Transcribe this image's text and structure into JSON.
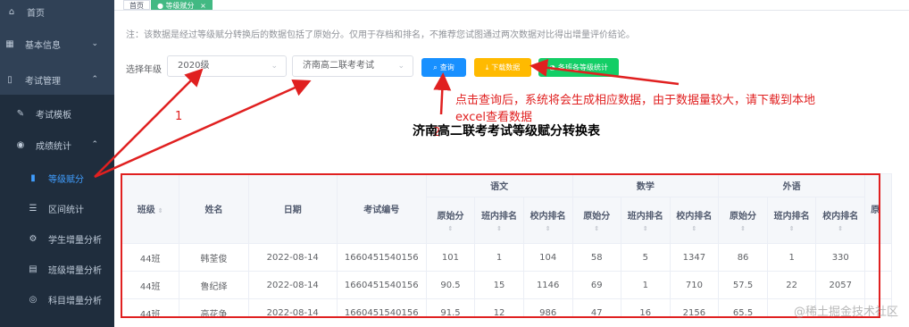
{
  "sidebar": {
    "items": [
      {
        "icon": "home-icon",
        "glyph": "⌂",
        "label": "首页"
      },
      {
        "icon": "grid-icon",
        "glyph": "▦",
        "label": "基本信息"
      },
      {
        "icon": "book-icon",
        "glyph": "▯",
        "label": "考试管理"
      },
      {
        "icon": "document-icon",
        "glyph": "✎",
        "label": "考试模板"
      },
      {
        "icon": "eye-icon",
        "glyph": "◉",
        "label": "成绩统计"
      },
      {
        "icon": "bar-chart-icon",
        "glyph": "▮",
        "label": "等级赋分"
      },
      {
        "icon": "list-icon",
        "glyph": "☰",
        "label": "区间统计"
      },
      {
        "icon": "gear-icon",
        "glyph": "⚙",
        "label": "学生增量分析"
      },
      {
        "icon": "table-icon",
        "glyph": "▤",
        "label": "班级增量分析"
      },
      {
        "icon": "circle-icon",
        "glyph": "◎",
        "label": "科目增量分析"
      }
    ]
  },
  "tabs": [
    {
      "label": "首页"
    },
    {
      "label": "● 等级赋分",
      "close": "×"
    }
  ],
  "notice": "注：该数据是经过等级赋分转换后的数据包括了原始分。仅用于存档和排名，不推荐您试图通过两次数据对比得出增量评价结论。",
  "filter": {
    "grade_label": "选择年级",
    "grade_value": "2020级",
    "exam_value": "济南高二联考考试",
    "query_label": "查询",
    "download_label": "下载数据",
    "stats_label": "各班各等级统计"
  },
  "annotations": {
    "num1": "1",
    "num2": "2",
    "hint_line1": "点击查询后，系统将会生成相应数据，由于数据量较大，请下载到本地",
    "hint_line2": "excel查看数据"
  },
  "table_title": "济南高二联考考试等级赋分转换表",
  "table": {
    "fixed_headers": [
      "班级",
      "姓名",
      "日期",
      "考试编号"
    ],
    "subject_groups": [
      "语文",
      "数学",
      "外语"
    ],
    "sub_headers": [
      "原始分",
      "班内排名",
      "校内排名"
    ],
    "overflow_header": "原",
    "rows": [
      [
        "44班",
        "韩荃俊",
        "2022-08-14",
        "1660451540156",
        "101",
        "1",
        "104",
        "58",
        "5",
        "1347",
        "86",
        "1",
        "330"
      ],
      [
        "44班",
        "鲁纪绎",
        "2022-08-14",
        "1660451540156",
        "90.5",
        "15",
        "1146",
        "69",
        "1",
        "710",
        "57.5",
        "22",
        "2057"
      ],
      [
        "44班",
        "高花争",
        "2022-08-14",
        "1660451540156",
        "91.5",
        "12",
        "986",
        "47",
        "16",
        "2156",
        "65.5",
        "",
        ""
      ]
    ]
  },
  "watermark": "@稀土掘金技术社区",
  "colors": {
    "sidebar_bg": "#304156",
    "active_blue": "#409eff",
    "annotation_red": "#e02020",
    "tab_active": "#42b983"
  }
}
